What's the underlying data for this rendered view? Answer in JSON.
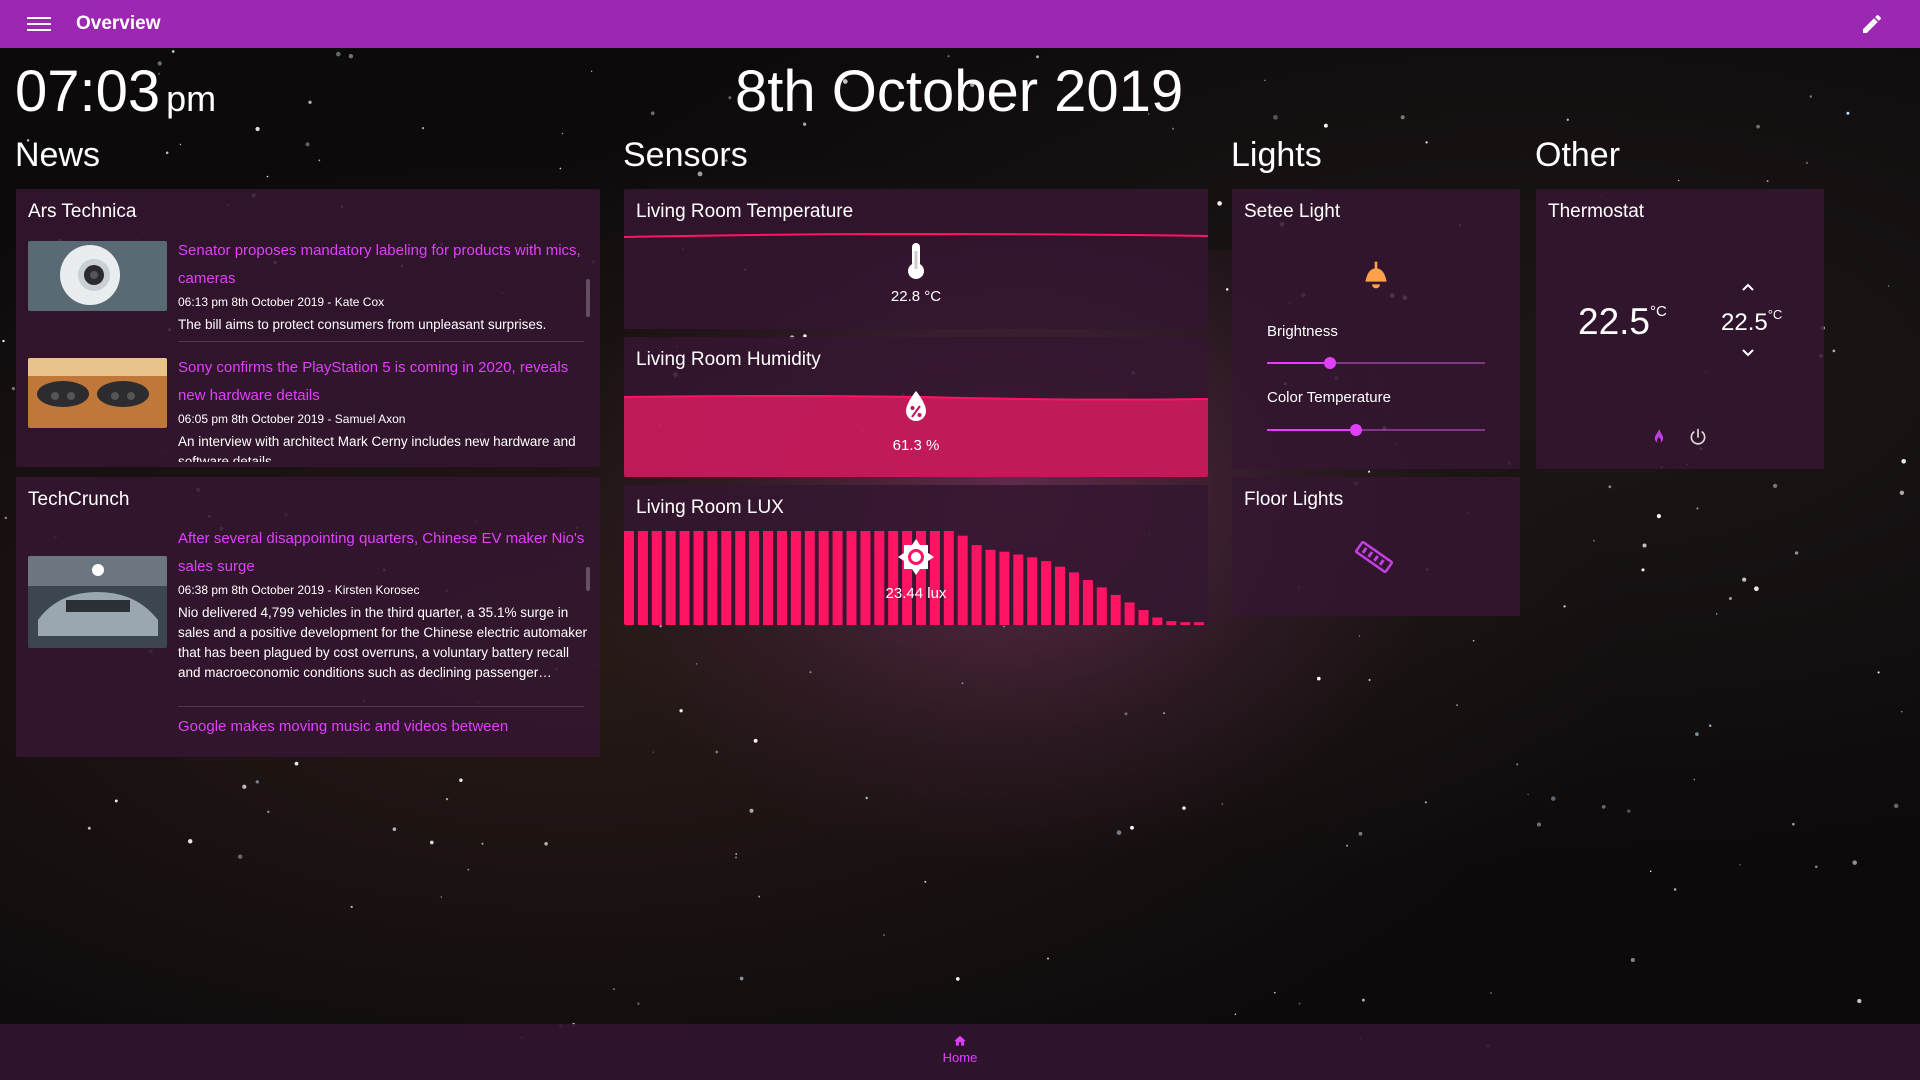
{
  "topbar": {
    "title": "Overview"
  },
  "header": {
    "time": "07:03",
    "ampm": "pm",
    "date": "8th October 2019"
  },
  "columns": {
    "news": "News",
    "sensors": "Sensors",
    "lights": "Lights",
    "other": "Other"
  },
  "news": {
    "ars": {
      "title": "Ars Technica",
      "items": [
        {
          "headline": "Senator proposes mandatory labeling for products with mics, cameras",
          "meta": "06:13 pm 8th October 2019 - Kate Cox",
          "desc": "The bill aims to protect consumers from unpleasant surprises."
        },
        {
          "headline": "Sony confirms the PlayStation 5 is coming in 2020, reveals new hardware details",
          "meta": "06:05 pm 8th October 2019 - Samuel Axon",
          "desc": "An interview with architect Mark Cerny includes new hardware and software details"
        }
      ]
    },
    "techcrunch": {
      "title": "TechCrunch",
      "items": [
        {
          "headline": "After several disappointing quarters, Chinese EV maker Nio's sales surge",
          "meta": "06:38 pm 8th October 2019 - Kirsten Korosec",
          "desc": "Nio delivered 4,799 vehicles in the third quarter, a 35.1% surge in sales and a positive development for the Chinese electric automaker that has been plagued by cost overruns, a voluntary battery recall and macroeconomic conditions such as declining passenger…"
        },
        {
          "headline": "Google makes moving music and videos between"
        }
      ]
    }
  },
  "sensors": {
    "temperature": {
      "title": "Living Room Temperature",
      "value": "22.8 °C"
    },
    "humidity": {
      "title": "Living Room Humidity",
      "value": "61.3 %"
    },
    "lux": {
      "title": "Living Room LUX",
      "value": "23.44 lux",
      "history": [
        100,
        100,
        100,
        100,
        100,
        100,
        100,
        100,
        100,
        100,
        100,
        100,
        100,
        100,
        100,
        100,
        100,
        100,
        100,
        100,
        100,
        100,
        100,
        100,
        95,
        85,
        80,
        78,
        75,
        72,
        68,
        62,
        56,
        48,
        40,
        32,
        24,
        16,
        8,
        4,
        3,
        3
      ]
    }
  },
  "lights": {
    "setee": {
      "title": "Setee Light",
      "brightness_label": "Brightness",
      "brightness": 0.29,
      "color_temp_label": "Color Temperature",
      "color_temp": 0.41
    },
    "floor": {
      "title": "Floor Lights"
    }
  },
  "other": {
    "thermostat": {
      "title": "Thermostat",
      "current": "22.5",
      "current_unit": "°C",
      "target": "22.5",
      "target_unit": "°C"
    }
  },
  "bottom": {
    "home": "Home"
  },
  "colors": {
    "accent": "#e040fb",
    "topbar": "#9c27b0",
    "sensor": "#ff1464",
    "bulb": "#ffa04a"
  }
}
